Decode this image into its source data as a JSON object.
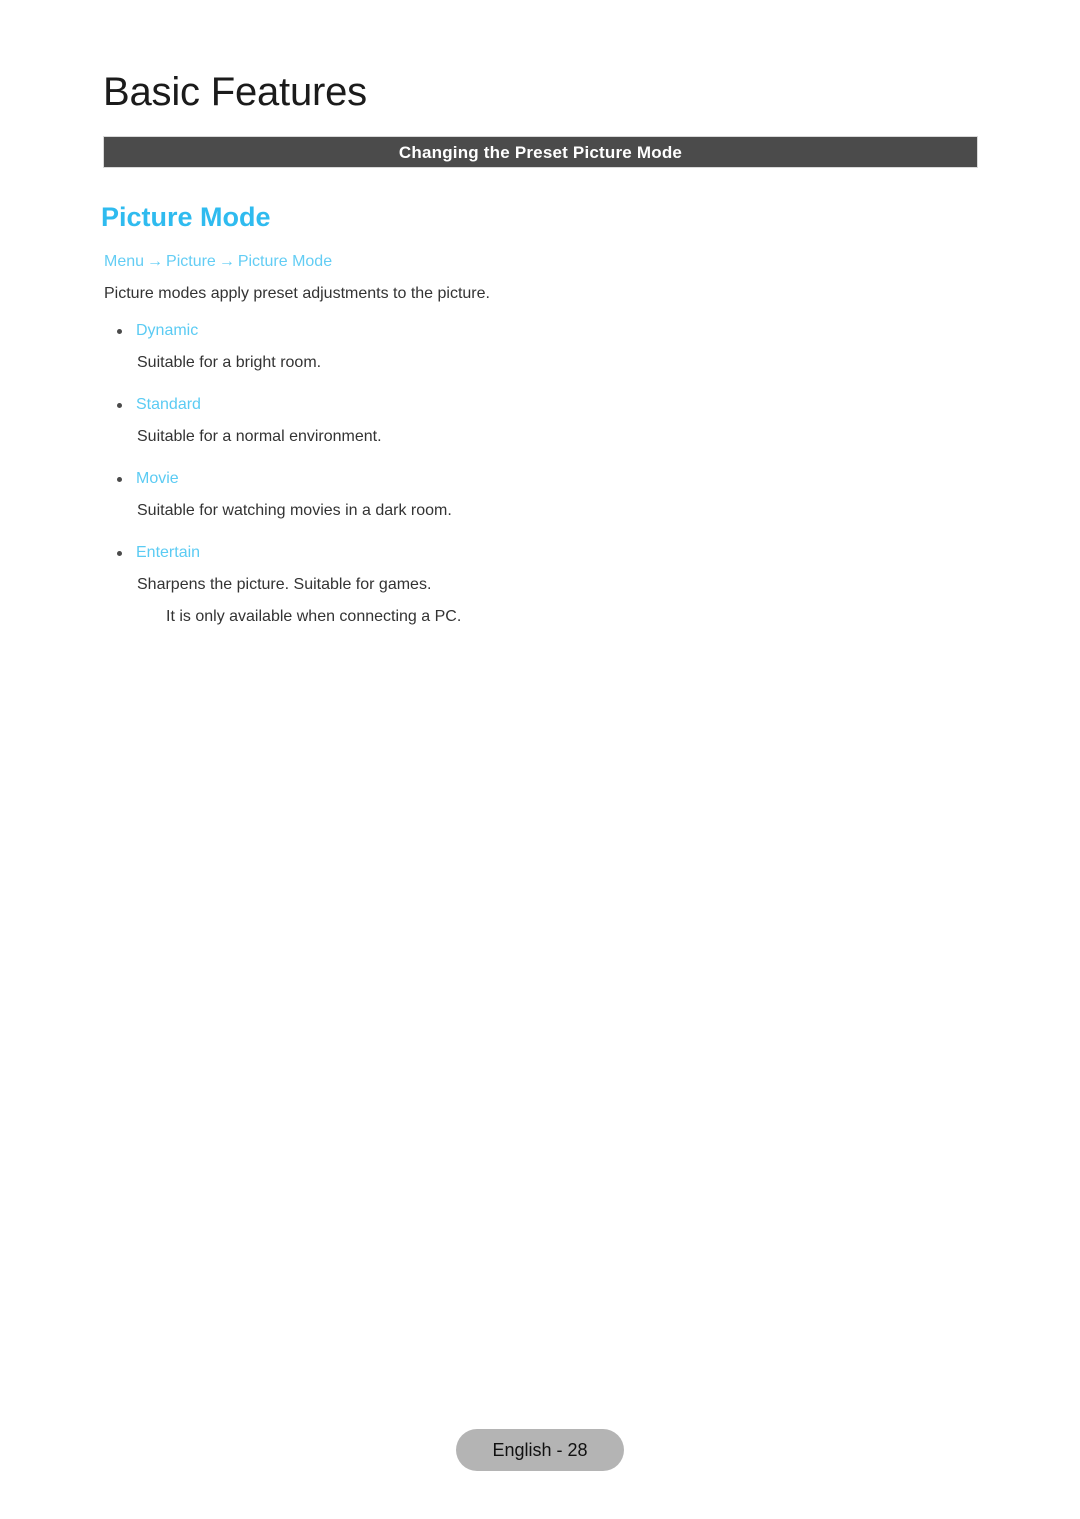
{
  "document": {
    "chapter_title": "Basic Features",
    "section_bar_title": "Changing the Preset Picture Mode",
    "topic_heading": "Picture Mode"
  },
  "breadcrumb": {
    "items": [
      "Menu",
      "Picture",
      "Picture Mode"
    ],
    "separator": "→"
  },
  "content": {
    "intro": "Picture modes apply preset adjustments to the picture.",
    "modes": [
      {
        "label": "Dynamic",
        "description": "Suitable for a bright room.",
        "note": ""
      },
      {
        "label": "Standard",
        "description": "Suitable for a normal environment.",
        "note": ""
      },
      {
        "label": "Movie",
        "description": "Suitable for watching movies in a dark room.",
        "note": ""
      },
      {
        "label": "Entertain",
        "description": "Sharpens the picture. Suitable for games.",
        "note": "It is only available when connecting a PC."
      }
    ]
  },
  "footer": {
    "page_label": "English - 28"
  },
  "colors": {
    "accent_heading": "#2fbbef",
    "accent_link": "#63cdf4",
    "accent_label": "#5bcbf3",
    "section_bar_bg": "#4b4b4b",
    "body_text": "#333333",
    "chapter_text": "#1b1b1b",
    "badge_bg": "#b4b4b4"
  }
}
